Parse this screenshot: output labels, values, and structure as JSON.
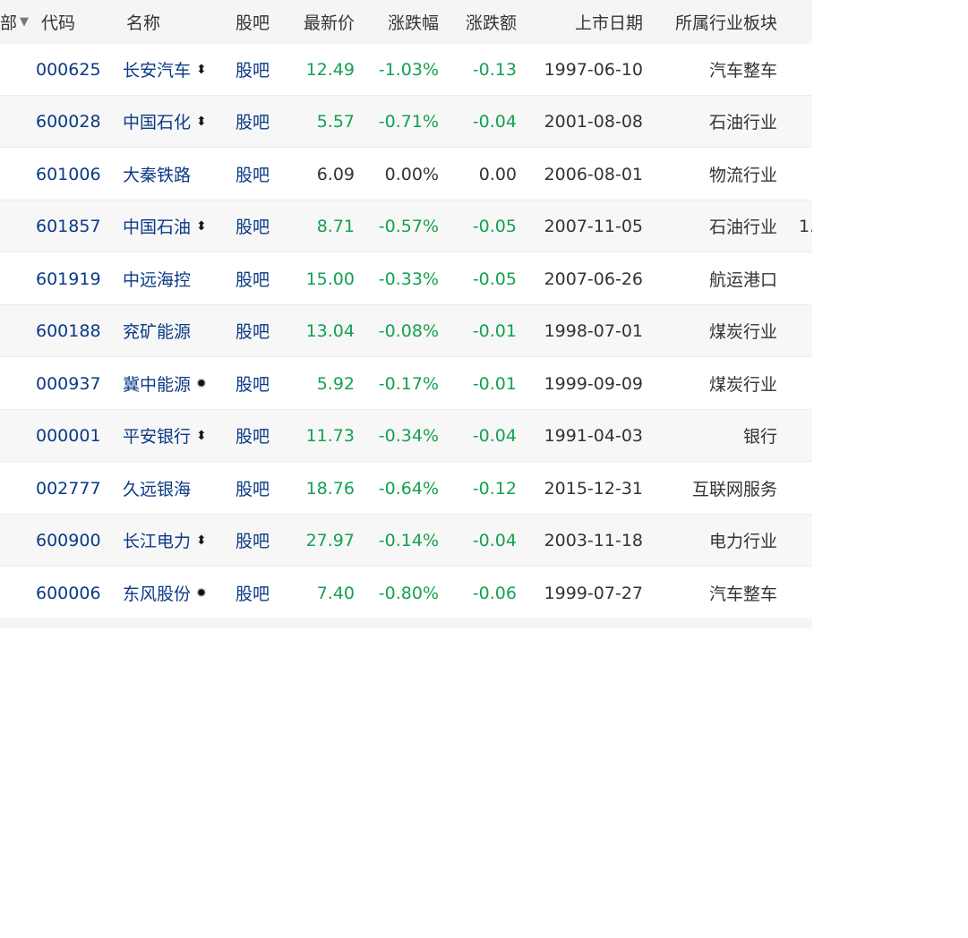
{
  "header": {
    "prev_label": "部",
    "prev_sort_icon": "triangle-down",
    "code": "代码",
    "name": "名称",
    "bar": "股吧",
    "price": "最新价",
    "pct": "涨跌幅",
    "chg": "涨跌额",
    "date": "上市日期",
    "industry": "所属行业板块"
  },
  "marks": {
    "updown": "⬍",
    "star": "✹"
  },
  "colors": {
    "link": "#0b3a86",
    "down": "#14a150",
    "flat": "#333333",
    "alt_row": "#f7f7f7",
    "header_bg": "#f5f5f5"
  },
  "rows": [
    {
      "code": "000625",
      "name": "长安汽车",
      "mark": "updown",
      "bar": "股吧",
      "price": "12.49",
      "pct": "-1.03%",
      "chg": "-0.13",
      "date": "1997-06-10",
      "industry": "汽车整车",
      "trend": "down",
      "extra": ""
    },
    {
      "code": "600028",
      "name": "中国石化",
      "mark": "updown",
      "bar": "股吧",
      "price": "5.57",
      "pct": "-0.71%",
      "chg": "-0.04",
      "date": "2001-08-08",
      "industry": "石油行业",
      "trend": "down",
      "extra": ""
    },
    {
      "code": "601006",
      "name": "大秦铁路",
      "mark": "",
      "bar": "股吧",
      "price": "6.09",
      "pct": "0.00%",
      "chg": "0.00",
      "date": "2006-08-01",
      "industry": "物流行业",
      "trend": "flat",
      "extra": ""
    },
    {
      "code": "601857",
      "name": "中国石油",
      "mark": "updown",
      "bar": "股吧",
      "price": "8.71",
      "pct": "-0.57%",
      "chg": "-0.05",
      "date": "2007-11-05",
      "industry": "石油行业",
      "trend": "down",
      "extra": "1."
    },
    {
      "code": "601919",
      "name": "中远海控",
      "mark": "",
      "bar": "股吧",
      "price": "15.00",
      "pct": "-0.33%",
      "chg": "-0.05",
      "date": "2007-06-26",
      "industry": "航运港口",
      "trend": "down",
      "extra": ""
    },
    {
      "code": "600188",
      "name": "兖矿能源",
      "mark": "",
      "bar": "股吧",
      "price": "13.04",
      "pct": "-0.08%",
      "chg": "-0.01",
      "date": "1998-07-01",
      "industry": "煤炭行业",
      "trend": "down",
      "extra": ""
    },
    {
      "code": "000937",
      "name": "冀中能源",
      "mark": "star",
      "bar": "股吧",
      "price": "5.92",
      "pct": "-0.17%",
      "chg": "-0.01",
      "date": "1999-09-09",
      "industry": "煤炭行业",
      "trend": "down",
      "extra": ""
    },
    {
      "code": "000001",
      "name": "平安银行",
      "mark": "updown",
      "bar": "股吧",
      "price": "11.73",
      "pct": "-0.34%",
      "chg": "-0.04",
      "date": "1991-04-03",
      "industry": "银行",
      "trend": "down",
      "extra": ""
    },
    {
      "code": "002777",
      "name": "久远银海",
      "mark": "",
      "bar": "股吧",
      "price": "18.76",
      "pct": "-0.64%",
      "chg": "-0.12",
      "date": "2015-12-31",
      "industry": "互联网服务",
      "trend": "down",
      "extra": ""
    },
    {
      "code": "600900",
      "name": "长江电力",
      "mark": "updown",
      "bar": "股吧",
      "price": "27.97",
      "pct": "-0.14%",
      "chg": "-0.04",
      "date": "2003-11-18",
      "industry": "电力行业",
      "trend": "down",
      "extra": ""
    },
    {
      "code": "600006",
      "name": "东风股份",
      "mark": "star",
      "bar": "股吧",
      "price": "7.40",
      "pct": "-0.80%",
      "chg": "-0.06",
      "date": "1999-07-27",
      "industry": "汽车整车",
      "trend": "down",
      "extra": ""
    }
  ]
}
